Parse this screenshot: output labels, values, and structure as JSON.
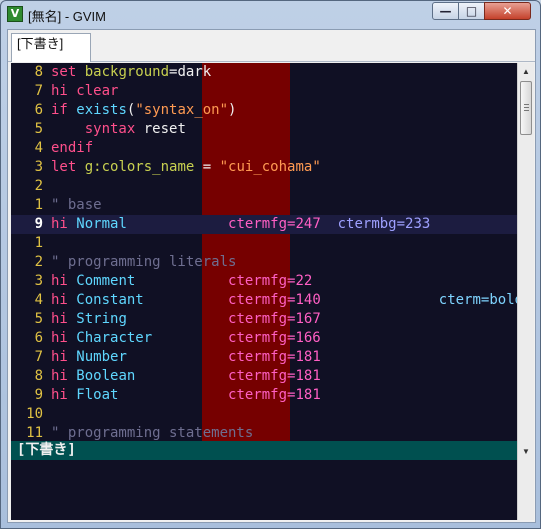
{
  "window": {
    "title": "[無名] - GVIM",
    "buttons": {
      "minimize": "—",
      "maximize": "□",
      "close": "✕"
    }
  },
  "tab": {
    "label": "[下書き]"
  },
  "statusline": {
    "text": "[下書き]"
  },
  "colors": {
    "background": "#101024",
    "colorcolumn": "#760000",
    "statusline": "#005050",
    "linenr": "#e0c244"
  },
  "lines": [
    {
      "num": "8",
      "tokens": [
        [
          "kw",
          "set"
        ],
        [
          "ident",
          " "
        ],
        [
          "var",
          "background"
        ],
        [
          "ident",
          "=dark"
        ]
      ]
    },
    {
      "num": "7",
      "tokens": [
        [
          "kw",
          "hi"
        ],
        [
          "ident",
          " "
        ],
        [
          "kw",
          "clear"
        ]
      ]
    },
    {
      "num": "6",
      "tokens": [
        [
          "kw",
          "if"
        ],
        [
          "ident",
          " "
        ],
        [
          "fn",
          "exists"
        ],
        [
          "ident",
          "("
        ],
        [
          "str",
          "\"syntax_on\""
        ],
        [
          "ident",
          ")"
        ]
      ]
    },
    {
      "num": "5",
      "tokens": [
        [
          "ident",
          "    "
        ],
        [
          "kw",
          "syntax"
        ],
        [
          "ident",
          " reset"
        ]
      ]
    },
    {
      "num": "4",
      "tokens": [
        [
          "kw",
          "endif"
        ]
      ]
    },
    {
      "num": "3",
      "tokens": [
        [
          "kw",
          "let"
        ],
        [
          "ident",
          " "
        ],
        [
          "var",
          "g:colors_name"
        ],
        [
          "ident",
          " = "
        ],
        [
          "str",
          "\"cui_cohama\""
        ]
      ]
    },
    {
      "num": "2",
      "tokens": []
    },
    {
      "num": "1",
      "tokens": [
        [
          "cm",
          "\" base"
        ]
      ]
    },
    {
      "num": "9",
      "current": true,
      "tokens": [
        [
          "kw",
          "hi"
        ],
        [
          "ident",
          " "
        ],
        [
          "fn",
          "Normal"
        ],
        [
          "ident",
          "            "
        ],
        [
          "ct",
          "ctermfg=247"
        ],
        [
          "ident",
          "  "
        ],
        [
          "ctb",
          "ctermbg=233"
        ]
      ]
    },
    {
      "num": "1",
      "tokens": []
    },
    {
      "num": "2",
      "tokens": [
        [
          "cm",
          "\" programming literals"
        ]
      ]
    },
    {
      "num": "3",
      "tokens": [
        [
          "kw",
          "hi"
        ],
        [
          "ident",
          " "
        ],
        [
          "fn",
          "Comment"
        ],
        [
          "ident",
          "           "
        ],
        [
          "ct",
          "ctermfg=22"
        ]
      ]
    },
    {
      "num": "4",
      "tokens": [
        [
          "kw",
          "hi"
        ],
        [
          "ident",
          " "
        ],
        [
          "fn",
          "Constant"
        ],
        [
          "ident",
          "          "
        ],
        [
          "ct",
          "ctermfg=140"
        ],
        [
          "ident",
          "              "
        ],
        [
          "ctbold",
          "cterm=bold"
        ]
      ]
    },
    {
      "num": "5",
      "tokens": [
        [
          "kw",
          "hi"
        ],
        [
          "ident",
          " "
        ],
        [
          "fn",
          "String"
        ],
        [
          "ident",
          "            "
        ],
        [
          "ct",
          "ctermfg=167"
        ]
      ]
    },
    {
      "num": "6",
      "tokens": [
        [
          "kw",
          "hi"
        ],
        [
          "ident",
          " "
        ],
        [
          "fn",
          "Character"
        ],
        [
          "ident",
          "         "
        ],
        [
          "ct",
          "ctermfg=166"
        ]
      ]
    },
    {
      "num": "7",
      "tokens": [
        [
          "kw",
          "hi"
        ],
        [
          "ident",
          " "
        ],
        [
          "fn",
          "Number"
        ],
        [
          "ident",
          "            "
        ],
        [
          "ct",
          "ctermfg=181"
        ]
      ]
    },
    {
      "num": "8",
      "tokens": [
        [
          "kw",
          "hi"
        ],
        [
          "ident",
          " "
        ],
        [
          "fn",
          "Boolean"
        ],
        [
          "ident",
          "           "
        ],
        [
          "ct",
          "ctermfg=181"
        ]
      ]
    },
    {
      "num": "9",
      "tokens": [
        [
          "kw",
          "hi"
        ],
        [
          "ident",
          " "
        ],
        [
          "fn",
          "Float"
        ],
        [
          "ident",
          "             "
        ],
        [
          "ct",
          "ctermfg=181"
        ]
      ]
    },
    {
      "num": "10",
      "tokens": []
    },
    {
      "num": "11",
      "tokens": [
        [
          "cm",
          "\" programming statements"
        ]
      ]
    }
  ]
}
